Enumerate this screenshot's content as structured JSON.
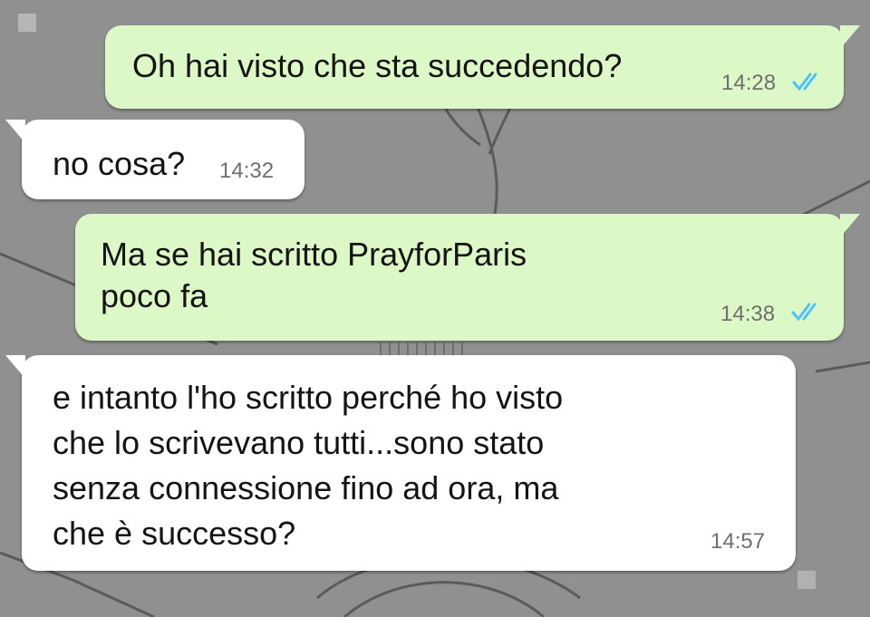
{
  "messages": [
    {
      "direction": "outgoing",
      "text": "Oh hai visto che sta succedendo?",
      "time": "14:28",
      "status": "read",
      "status_icon": "double-check-icon",
      "status_color": "#4fc3f7"
    },
    {
      "direction": "incoming",
      "text": "no cosa?",
      "time": "14:32"
    },
    {
      "direction": "outgoing",
      "text": "Ma se hai scritto PrayforParis\npoco fa",
      "time": "14:38",
      "status": "read",
      "status_icon": "double-check-icon",
      "status_color": "#4fc3f7"
    },
    {
      "direction": "incoming",
      "text": "e intanto l'ho scritto perché ho visto\nche lo scrivevano tutti...sono stato\nsenza connessione fino ad ora, ma\nche è successo?",
      "time": "14:57"
    }
  ],
  "colors": {
    "outgoing_bubble": "#dcf8c6",
    "incoming_bubble": "#ffffff",
    "tick": "#4fc3f7"
  }
}
